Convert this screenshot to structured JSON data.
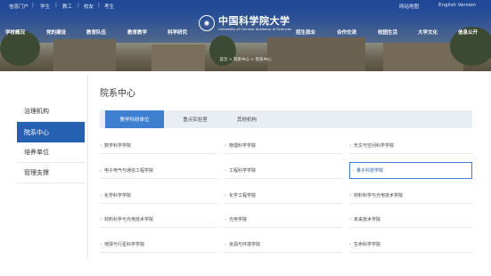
{
  "topbar": {
    "left_links": [
      "信息门户",
      "学生",
      "教工",
      "校友",
      "考生"
    ],
    "right_links": [
      "网站地图",
      "English Version"
    ]
  },
  "logo": {
    "cn": "中国科学院大学",
    "en": "University of Chinese Academy of Sciences"
  },
  "nav": {
    "items": [
      "学校概况",
      "党的建设",
      "教育队伍",
      "教育教学",
      "科学研究",
      "招生就业",
      "合作交流",
      "校园生活",
      "大学文化",
      "信息公开"
    ]
  },
  "breadcrumb": "首页 > 院系中心 > 院系中心",
  "sidebar": {
    "items": [
      "治理机构",
      "院系中心",
      "培养单位",
      "管理支撑"
    ],
    "active_index": 1
  },
  "main": {
    "title": "院系中心",
    "tabs": [
      "教学科研单位",
      "重点实验室",
      "其他机构"
    ],
    "active_tab": 0,
    "grid": [
      [
        "数学科学学院",
        "物理科学学院",
        "天文与空间科学学院"
      ],
      [
        "电子电气与通信工程学院",
        "工程科学学院",
        "量子科技学院"
      ],
      [
        "化学科学学院",
        "化学工程学院",
        "材料科学与光电技术学院"
      ],
      [
        "材料科学与光电技术学院",
        "光电学院",
        "未来技术学院"
      ],
      [
        "地球与行星科学学院",
        "资源与环境学院",
        "生命科学学院"
      ]
    ],
    "highlighted": "量子科技学院"
  },
  "colors": {
    "brand_blue": "#2660b3",
    "tab_active": "#3f7fd0",
    "tab_bar": "#e9eef5"
  }
}
